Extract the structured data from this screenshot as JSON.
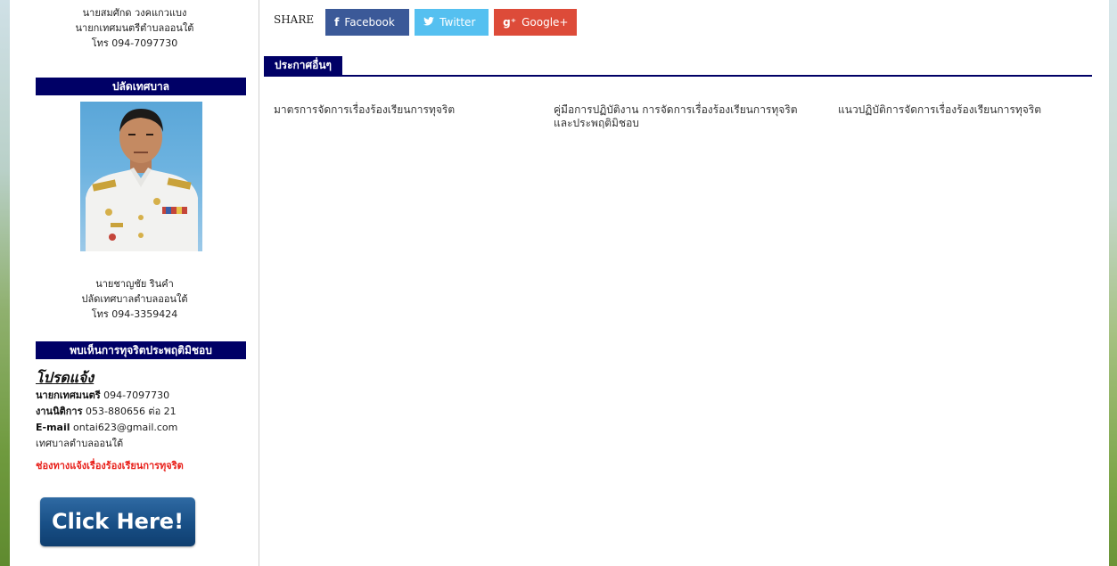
{
  "sidebar": {
    "mayor": {
      "name": "นายสมศักด วงคแกวแบง",
      "position": "นายกเทศมนตรีตำบลออนใต้",
      "phone": "โทร 094-7097730"
    },
    "deputy_section": {
      "title": "ปลัดเทศบาล",
      "name": "นายชาญชัย รินคำ",
      "position": "ปลัดเทศบาลตำบลออนใต้",
      "phone": "โทร 094-3359424"
    },
    "report_section": {
      "title": "พบเห็นการทุจริตประพฤติมิชอบ",
      "heading": "โปรดแจ้ง",
      "mayor_label": "นายกเทศมนตรี",
      "mayor_phone": "094-7097730",
      "office_label": "งานนิติการ",
      "office_phone": "053-880656 ต่อ 21",
      "email_label": "E-mail",
      "email": "ontai623@gmail.com",
      "org": "เทศบาลตำบลออนใต้",
      "complaint_link": "ช่องทางแจ้งเรื่องร้องเรียนการทุจริต",
      "click_button": "Click Here!"
    }
  },
  "main": {
    "share": {
      "label": "SHARE",
      "facebook": "Facebook",
      "twitter": "Twitter",
      "google": "Google+"
    },
    "announcements": {
      "title": "ประกาศอื่นๆ",
      "items": [
        "มาตรการจัดการเรื่องร้องเรียนการทุจริต",
        "คู่มือการปฏิบัติงาน การจัดการเรื่องร้องเรียนการทุจริต และประพฤติมิชอบ",
        "แนวปฏิบัติการจัดการเรื่องร้องเรียนการทุจริต"
      ]
    }
  },
  "icons": {
    "facebook": "facebook-icon",
    "twitter": "twitter-icon",
    "google": "google-plus-icon"
  },
  "colors": {
    "accent_navy": "#000066",
    "facebook": "#3b5998",
    "twitter": "#55c0f0",
    "google": "#dd4b39",
    "alert_red": "#e8201a",
    "button_blue": "#184f86"
  }
}
